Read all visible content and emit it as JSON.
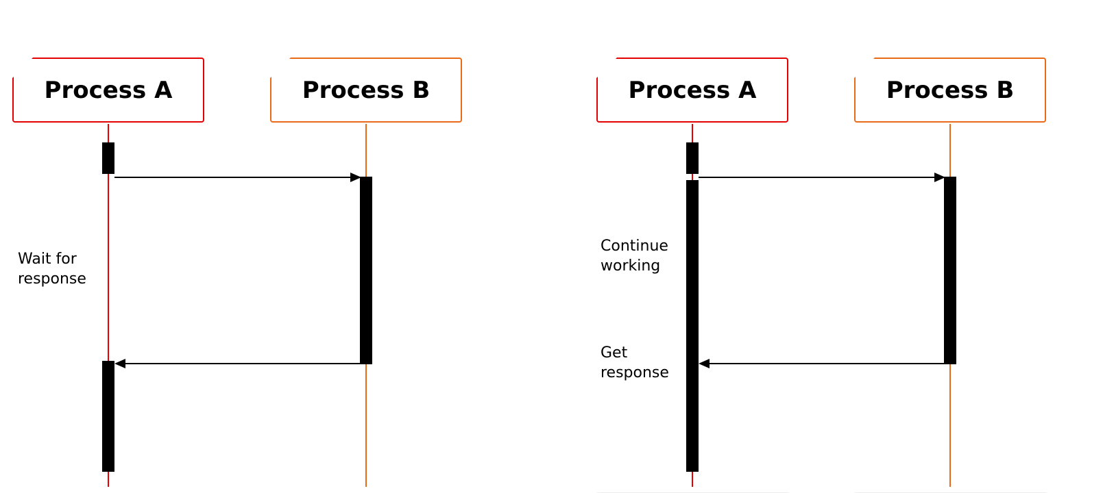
{
  "diagrams": {
    "left": {
      "process_a": {
        "label": "Process A",
        "color": "red"
      },
      "process_b": {
        "label": "Process B",
        "color": "orange"
      },
      "note_line1": "Wait for",
      "note_line2": "response"
    },
    "right": {
      "process_a": {
        "label": "Process A",
        "color": "red"
      },
      "process_b": {
        "label": "Process B",
        "color": "orange"
      },
      "note1_line1": "Continue",
      "note1_line2": "working",
      "note2_line1": "Get",
      "note2_line2": "response"
    }
  },
  "colors": {
    "red": "#e40000",
    "orange": "#e86a17",
    "lane_bg": "#ececec",
    "arrow": "#000000"
  }
}
